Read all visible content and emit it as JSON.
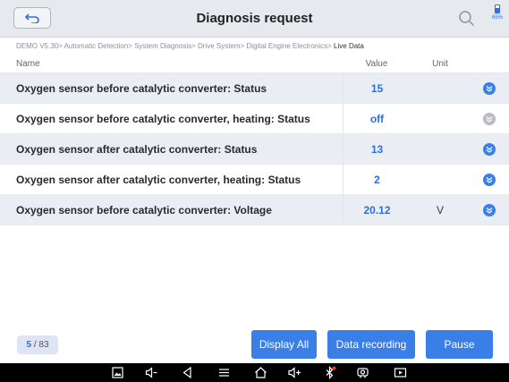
{
  "header": {
    "title": "Diagnosis request",
    "battery_percent": "65%"
  },
  "breadcrumb": {
    "path": "DEMO V5.30> Automatic Detection> System Diagnosis> Drive System> Digital Engine Electronics> ",
    "current": "Live Data"
  },
  "table": {
    "columns": {
      "name": "Name",
      "value": "Value",
      "unit": "Unit"
    },
    "rows": [
      {
        "name": "Oxygen sensor before catalytic converter: Status",
        "value": "15",
        "unit": ""
      },
      {
        "name": "Oxygen sensor before catalytic converter, heating: Status",
        "value": "off",
        "unit": ""
      },
      {
        "name": "Oxygen sensor after catalytic converter: Status",
        "value": "13",
        "unit": ""
      },
      {
        "name": "Oxygen sensor after catalytic converter, heating: Status",
        "value": "2",
        "unit": ""
      },
      {
        "name": "Oxygen sensor before catalytic converter: Voltage",
        "value": "20.12",
        "unit": "V"
      }
    ]
  },
  "footer": {
    "page_current": "5",
    "page_total": "/ 83",
    "display_all_label": "Display All",
    "data_recording_label": "Data recording",
    "pause_label": "Pause"
  },
  "colors": {
    "accent": "#3a7fe8",
    "value_text": "#2f6fdb",
    "row_alt": "#eaeef4",
    "topbar": "#e6e9ee"
  },
  "navbar_icons": [
    "screenshot-icon",
    "volume-down-icon",
    "back-icon",
    "menu-icon",
    "home-icon",
    "volume-up-icon",
    "bluetooth-icon",
    "vci-connector-icon",
    "screen-record-icon"
  ]
}
